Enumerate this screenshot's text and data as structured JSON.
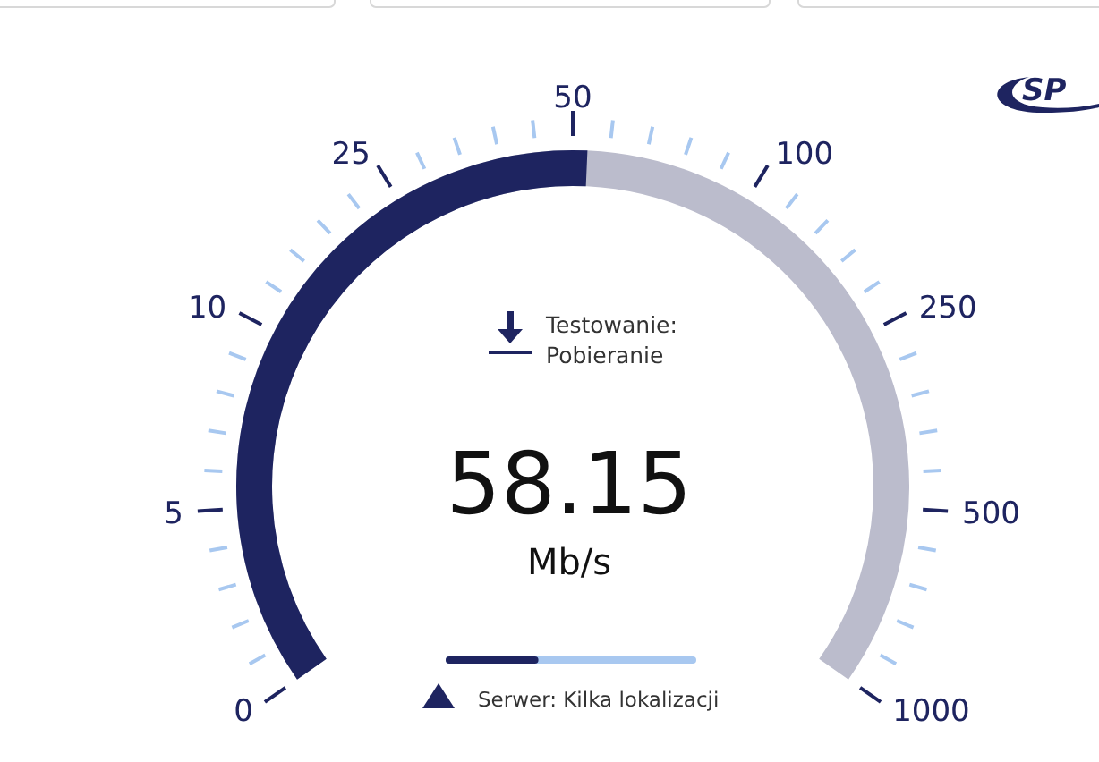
{
  "logo": {
    "text": "SP"
  },
  "gauge": {
    "scale": [
      "0",
      "5",
      "10",
      "25",
      "50",
      "100",
      "250",
      "500",
      "1000"
    ],
    "status_label": "Testowanie:",
    "status_value": "Pobieranie",
    "speed": "58.15",
    "unit": "Mb/s"
  },
  "progress": {
    "level": 0.37
  },
  "server": {
    "text": "Serwer: Kilka lokalizacji"
  }
}
